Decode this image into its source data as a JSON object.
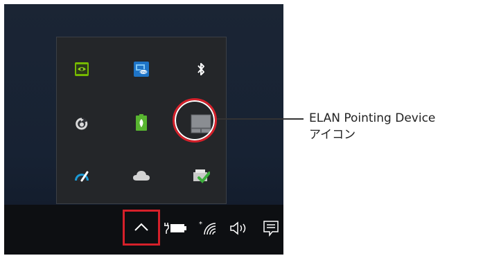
{
  "callout": {
    "line1": "ELAN Pointing Device",
    "line2": "アイコン"
  },
  "flyout_icons": [
    {
      "name": "nvidia-icon"
    },
    {
      "name": "intel-graphics-icon"
    },
    {
      "name": "bluetooth-icon"
    },
    {
      "name": "sync-arrow-icon"
    },
    {
      "name": "battery-leaf-icon"
    },
    {
      "name": "elan-pointing-device-icon"
    },
    {
      "name": "speedometer-icon"
    },
    {
      "name": "onedrive-cloud-icon"
    },
    {
      "name": "printer-check-icon"
    }
  ],
  "taskbar": {
    "icons": [
      "chevron-up-icon",
      "power-plug-battery-icon",
      "wifi-icon",
      "speaker-icon",
      "action-center-icon"
    ]
  },
  "colors": {
    "highlight": "#d5202a",
    "flyout_bg": "#242629",
    "taskbar_bg": "#0d0f12"
  }
}
